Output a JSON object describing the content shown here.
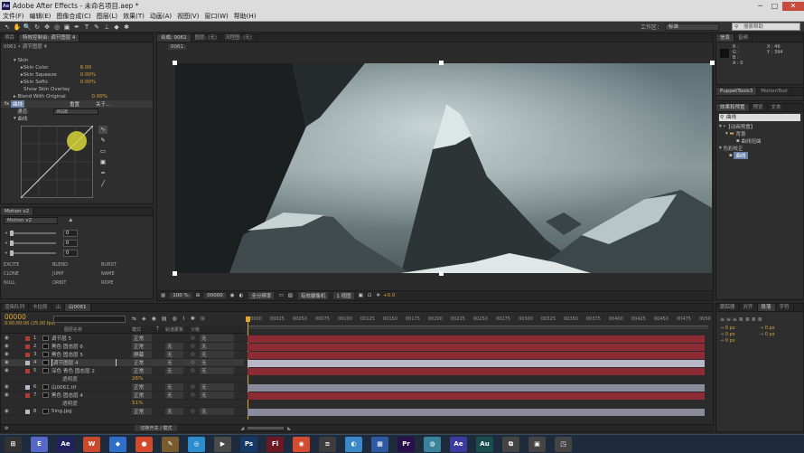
{
  "app": {
    "title": "Adobe After Effects - 未命名项目.aep *",
    "logo": "Ae",
    "min": "─",
    "max": "□",
    "close": "✕"
  },
  "menu": [
    "文件(F)",
    "编辑(E)",
    "图像合成(C)",
    "图层(L)",
    "效果(T)",
    "动画(A)",
    "视图(V)",
    "窗口(W)",
    "帮助(H)"
  ],
  "toolbar": {
    "tools": [
      "↖",
      "✋",
      "🔍",
      "↻",
      "✥",
      "◎",
      "▣",
      "✒",
      "T",
      "✎",
      "⊥",
      "◆",
      "✱"
    ],
    "workspace_label": "工作区：",
    "workspace_value": "标准",
    "search_placeholder": "搜索帮助"
  },
  "effects_panel": {
    "tabs": [
      "项目",
      "特效控制台: 调节图层 4"
    ],
    "breadcrumb": "0061 • 调节图层 4",
    "skin_label": "Skin",
    "props": [
      {
        "name": "Skin Color",
        "value": "6.00"
      },
      {
        "name": "Skin Squeeze",
        "value": "0.00%"
      },
      {
        "name": "Skin Softs",
        "value": "0.00%"
      }
    ],
    "show_overlay": "Show Skin Overlay",
    "blend": {
      "name": "Blend With Original",
      "value": "0.00%"
    },
    "fx_name": "曲线",
    "reset": "重置",
    "about": "关于...",
    "channel_label": "通道:",
    "channel_value": "RGB",
    "curve_label": "曲线"
  },
  "motion_panel": {
    "tab": "Motion v2",
    "preset": "Motion v2",
    "values": [
      "0",
      "0",
      "0"
    ],
    "buttons": [
      "EXCITE",
      "BLEND",
      "BURST",
      "CLONE",
      "JUMP",
      "NAME",
      "NULL",
      "ORBIT",
      "ROPE"
    ]
  },
  "comp_viewer": {
    "tabs": [
      "合成: 0061",
      "图层: (无)",
      "流程图: (无)"
    ],
    "comp_name": "0061",
    "zoom": "100 %",
    "timecode": "00000",
    "quality": "全分辨率",
    "camera": "有效摄像机",
    "views": "1 视图",
    "offset": "+0.0"
  },
  "info_panel": {
    "tabs": [
      "信息",
      "音频"
    ],
    "rgba": [
      "R :",
      "G :",
      "B :",
      "A : 0"
    ],
    "coords": [
      "X : 46",
      "Y : 394"
    ]
  },
  "puppet_panel": {
    "tabs": [
      "PuppetTools3",
      "MotionTool"
    ]
  },
  "effects_presets": {
    "tabs": [
      "效果和预置",
      "预览",
      "文本"
    ],
    "search": "曲线",
    "tree": [
      "*【动画预置】",
      "背景",
      "曲线扭曲",
      "色彩校正",
      "曲线"
    ]
  },
  "timeline": {
    "tabs": [
      "渲染队列",
      "卡拉原",
      "山",
      "山0061"
    ],
    "timecode": "00000",
    "fps": "0:00:00:00 (25.00 fps)",
    "search_placeholder": "",
    "col_headers": [
      "图层名称",
      "模式",
      "T",
      "轨道蒙板",
      "父级"
    ],
    "ruler": [
      "00000",
      "00025",
      "00050",
      "00075",
      "00100",
      "00125",
      "00150",
      "00175",
      "00200",
      "00225",
      "00250",
      "00275",
      "00300",
      "00325",
      "00350",
      "00375",
      "00400",
      "00425",
      "00450",
      "00475",
      "0050"
    ],
    "layers": [
      {
        "num": "1",
        "name": "调节层 5",
        "mode": "正常",
        "track": "",
        "parent": "无",
        "color": "#8c2b33",
        "sel": false
      },
      {
        "num": "2",
        "name": "黑色 固态层 6",
        "mode": "正常",
        "track": "无",
        "parent": "无",
        "color": "#8c2b33",
        "sel": false
      },
      {
        "num": "3",
        "name": "黑色 固态层 5",
        "mode": "屏幕",
        "track": "无",
        "parent": "无",
        "color": "#8c2b33",
        "sel": false
      },
      {
        "num": "4",
        "name": "调节图层 4",
        "mode": "正常",
        "track": "无",
        "parent": "无",
        "color": "#b7b7c8",
        "sel": true
      },
      {
        "num": "5",
        "name": "深色 青色 固态层 2",
        "mode": "正常",
        "track": "无",
        "parent": "无",
        "color": "#8c2b33",
        "sel": false
      },
      {
        "num": "",
        "name": "透明度",
        "mode": "",
        "track": "",
        "parent": "",
        "color": "",
        "sel": false,
        "sub": "26%"
      },
      {
        "num": "6",
        "name": "山0061.tif",
        "mode": "正常",
        "track": "无",
        "parent": "无",
        "color": "#8b8b9c",
        "sel": false
      },
      {
        "num": "7",
        "name": "黑色 固态层 4",
        "mode": "正常",
        "track": "无",
        "parent": "无",
        "color": "#8c2b33",
        "sel": false
      },
      {
        "num": "",
        "name": "透明度",
        "mode": "",
        "track": "",
        "parent": "",
        "color": "",
        "sel": false,
        "sub": "51%"
      },
      {
        "num": "8",
        "name": "5ing.jpg",
        "mode": "正常",
        "track": "无",
        "parent": "无",
        "color": "#8b8b9c",
        "sel": false
      }
    ],
    "bottom_button": "切换开关 / 模式"
  },
  "right_bottom": {
    "tabs": [
      "跟踪器",
      "对齐",
      "段落",
      "字符"
    ],
    "values": [
      "0 px",
      "0 px",
      "0 px",
      "0 px",
      "0 px"
    ]
  },
  "taskbar": {
    "icons": [
      {
        "label": "⊞",
        "color": "#333"
      },
      {
        "label": "E",
        "color": "#5568c9"
      },
      {
        "label": "Ae",
        "color": "#222160"
      },
      {
        "label": "W",
        "color": "#c94a2b"
      },
      {
        "label": "◆",
        "color": "#2f6ec9"
      },
      {
        "label": "●",
        "color": "#d24a2b"
      },
      {
        "label": "✎",
        "color": "#7a5b2d"
      },
      {
        "label": "◎",
        "color": "#2a8dd0"
      },
      {
        "label": "▶",
        "color": "#4a4a4a"
      },
      {
        "label": "Ps",
        "color": "#163a67"
      },
      {
        "label": "Fl",
        "color": "#6b1a24"
      },
      {
        "label": "◉",
        "color": "#d34c2f"
      },
      {
        "label": "≡",
        "color": "#3d3d3d"
      },
      {
        "label": "◐",
        "color": "#3a88c9"
      },
      {
        "label": "▦",
        "color": "#2d5aa0"
      },
      {
        "label": "Pr",
        "color": "#2a0f4d"
      },
      {
        "label": "◍",
        "color": "#39839b"
      },
      {
        "label": "Ae",
        "color": "#3b3aa0"
      },
      {
        "label": "Au",
        "color": "#1a4e4e"
      },
      {
        "label": "⧉",
        "color": "#444"
      },
      {
        "label": "▣",
        "color": "#444"
      },
      {
        "label": "◳",
        "color": "#444"
      }
    ]
  }
}
